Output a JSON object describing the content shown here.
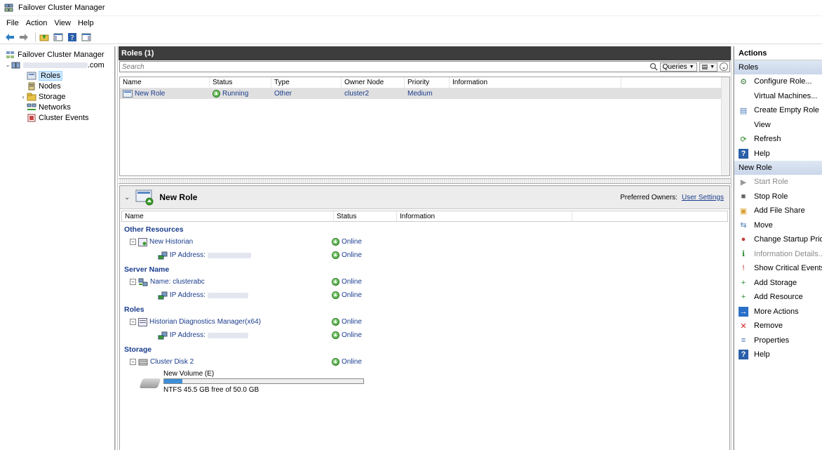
{
  "window": {
    "title": "Failover Cluster Manager"
  },
  "menu": [
    "File",
    "Action",
    "View",
    "Help"
  ],
  "tree": {
    "root": "Failover Cluster Manager",
    "cluster_suffix": ".com",
    "items": [
      {
        "label": "Roles",
        "selected": true
      },
      {
        "label": "Nodes"
      },
      {
        "label": "Storage",
        "expandable": true
      },
      {
        "label": "Networks"
      },
      {
        "label": "Cluster Events"
      }
    ]
  },
  "roles_pane": {
    "title": "Roles (1)",
    "search_placeholder": "Search",
    "queries_label": "Queries",
    "columns": [
      "Name",
      "Status",
      "Type",
      "Owner Node",
      "Priority",
      "Information"
    ],
    "rows": [
      {
        "name": "New Role",
        "status": "Running",
        "type": "Other",
        "owner": "cluster2",
        "priority": "Medium",
        "info": ""
      }
    ]
  },
  "detail": {
    "title": "New Role",
    "preferred_owners_label": "Preferred Owners:",
    "preferred_owners_link": "User Settings",
    "columns": [
      "Name",
      "Status",
      "Information"
    ],
    "groups": [
      {
        "title": "Other Resources",
        "items": [
          {
            "name": "New Historian",
            "status": "Online",
            "level": 0
          },
          {
            "name": "IP Address:",
            "status": "Online",
            "level": 1
          }
        ]
      },
      {
        "title": "Server Name",
        "items": [
          {
            "name": "Name: clusterabc",
            "status": "Online",
            "level": 0
          },
          {
            "name": "IP Address:",
            "status": "Online",
            "level": 1
          }
        ]
      },
      {
        "title": "Roles",
        "items": [
          {
            "name": "Historian Diagnostics Manager(x64)",
            "status": "Online",
            "level": 0
          },
          {
            "name": "IP Address:",
            "status": "Online",
            "level": 1
          }
        ]
      },
      {
        "title": "Storage",
        "items": [
          {
            "name": "Cluster Disk 2",
            "status": "Online",
            "level": 0
          }
        ]
      }
    ],
    "volume": {
      "name": "New Volume (E)",
      "free_text": "NTFS 45.5 GB free of 50.0 GB",
      "used_fraction": 0.09
    }
  },
  "actions": {
    "title": "Actions",
    "sections": [
      {
        "title": "Roles",
        "items": [
          {
            "label": "Configure Role...",
            "icon": "configure-role-icon"
          },
          {
            "label": "Virtual Machines...",
            "icon": ""
          },
          {
            "label": "Create Empty Role",
            "icon": "create-role-icon"
          },
          {
            "label": "View",
            "icon": ""
          },
          {
            "label": "Refresh",
            "icon": "refresh-icon"
          },
          {
            "label": "Help",
            "icon": "help-icon"
          }
        ]
      },
      {
        "title": "New Role",
        "items": [
          {
            "label": "Start Role",
            "icon": "start-role-icon",
            "disabled": true
          },
          {
            "label": "Stop Role",
            "icon": "stop-role-icon"
          },
          {
            "label": "Add File Share",
            "icon": "file-share-icon"
          },
          {
            "label": "Move",
            "icon": "move-icon"
          },
          {
            "label": "Change Startup Priority",
            "icon": "priority-icon"
          },
          {
            "label": "Information Details...",
            "icon": "info-details-icon",
            "disabled": true
          },
          {
            "label": "Show Critical Events",
            "icon": "critical-events-icon"
          },
          {
            "label": "Add Storage",
            "icon": "add-storage-icon"
          },
          {
            "label": "Add Resource",
            "icon": "add-resource-icon"
          },
          {
            "label": "More Actions",
            "icon": "more-actions-icon"
          },
          {
            "label": "Remove",
            "icon": "remove-icon"
          },
          {
            "label": "Properties",
            "icon": "properties-icon"
          },
          {
            "label": "Help",
            "icon": "help-icon"
          }
        ]
      }
    ]
  },
  "colors": {
    "header_dark": "#3d3d3d",
    "link_blue": "#1a3c8c",
    "selection": "#cce8ff",
    "online_green": "#3c9a2e"
  }
}
